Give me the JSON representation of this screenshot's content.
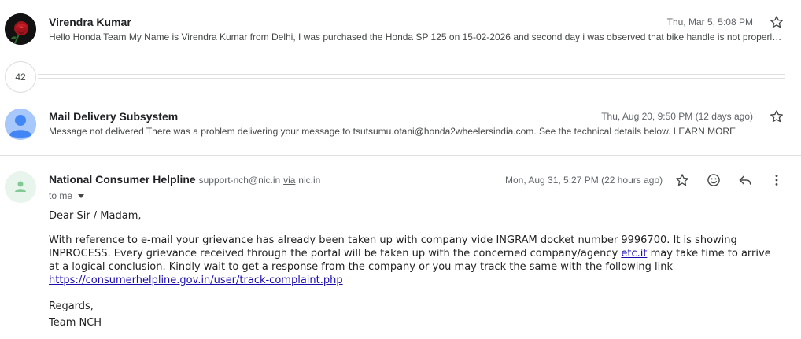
{
  "thread": {
    "messages": [
      {
        "sender": "Virendra Kumar",
        "date": "Thu, Mar 5, 5:08 PM",
        "snippet": "Hello Honda Team My Name is Virendra Kumar from Delhi, I was purchased the Honda SP 125 on 15-02-2026 and second day i was observed that bike handle is not properly aligned and vibrating while riding",
        "avatar_icon": "rose-photo-avatar"
      },
      {
        "sender": "Mail Delivery Subsystem",
        "date": "Thu, Aug 20, 9:50 PM (12 days ago)",
        "snippet": "Message not delivered There was a problem delivering your message to tsutsumu.otani@honda2wheelersindia.com. See the technical details below. LEARN MORE",
        "avatar_icon": "person-icon",
        "avatar_color": "#8ab4f8"
      }
    ],
    "collapsed_count": "42",
    "open_message": {
      "sender": "National Consumer Helpline",
      "email": "support-nch@nic.in",
      "via_label": "via",
      "via_domain": "nic.in",
      "date": "Mon, Aug 31, 5:27 PM (22 hours ago)",
      "to": "to me",
      "greeting": "Dear Sir / Madam,",
      "para_part1": "With reference to e-mail your grievance has already been taken up with company vide INGRAM docket number 9996700. It is showing INPROCESS. Every grievance received through the portal will be taken up with the concerned company/agency ",
      "para_link1": "etc.it",
      "para_part2": " may take time to arrive at a logical conclusion. Kindly wait to get a response from the company or you may track the same with the following link ",
      "para_link2": "https://consumerhelpline.gov.in/user/track-complaint.php",
      "signoff": "Regards,",
      "signature": "Team NCH",
      "avatar_icon": "person-icon",
      "avatar_color": "#81c995"
    }
  }
}
